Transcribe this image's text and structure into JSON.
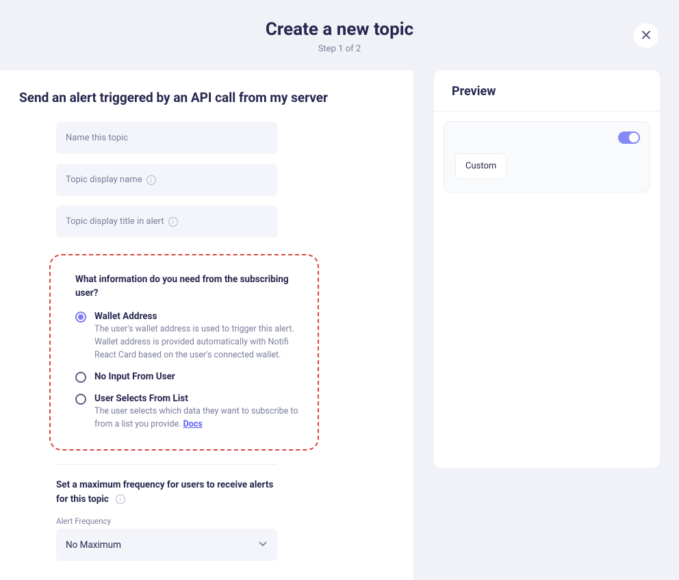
{
  "header": {
    "title": "Create a new topic",
    "step": "Step 1 of 2"
  },
  "main": {
    "title": "Send an alert triggered by an API call from my server",
    "inputs": {
      "name": {
        "placeholder": "Name this topic"
      },
      "displayName": {
        "placeholder": "Topic display name"
      },
      "displayTitle": {
        "placeholder": "Topic display title in alert"
      }
    },
    "question": {
      "label": "What information do you need from the subscribing user?",
      "options": {
        "wallet": {
          "title": "Wallet Address",
          "desc": "The user's wallet address is used to trigger this alert. Wallet address is provided automatically with Notifi React Card based on the user's connected wallet."
        },
        "none": {
          "title": "No Input From User"
        },
        "list": {
          "title": "User Selects From List",
          "desc": "The user selects which data they want to subscribe to from a list you provide. ",
          "docs": "Docs"
        }
      }
    },
    "frequency": {
      "label": "Set a maximum frequency for users to receive alerts for this topic",
      "sublabel": "Alert Frequency",
      "value": "No Maximum"
    }
  },
  "preview": {
    "title": "Preview",
    "chip": "Custom"
  }
}
